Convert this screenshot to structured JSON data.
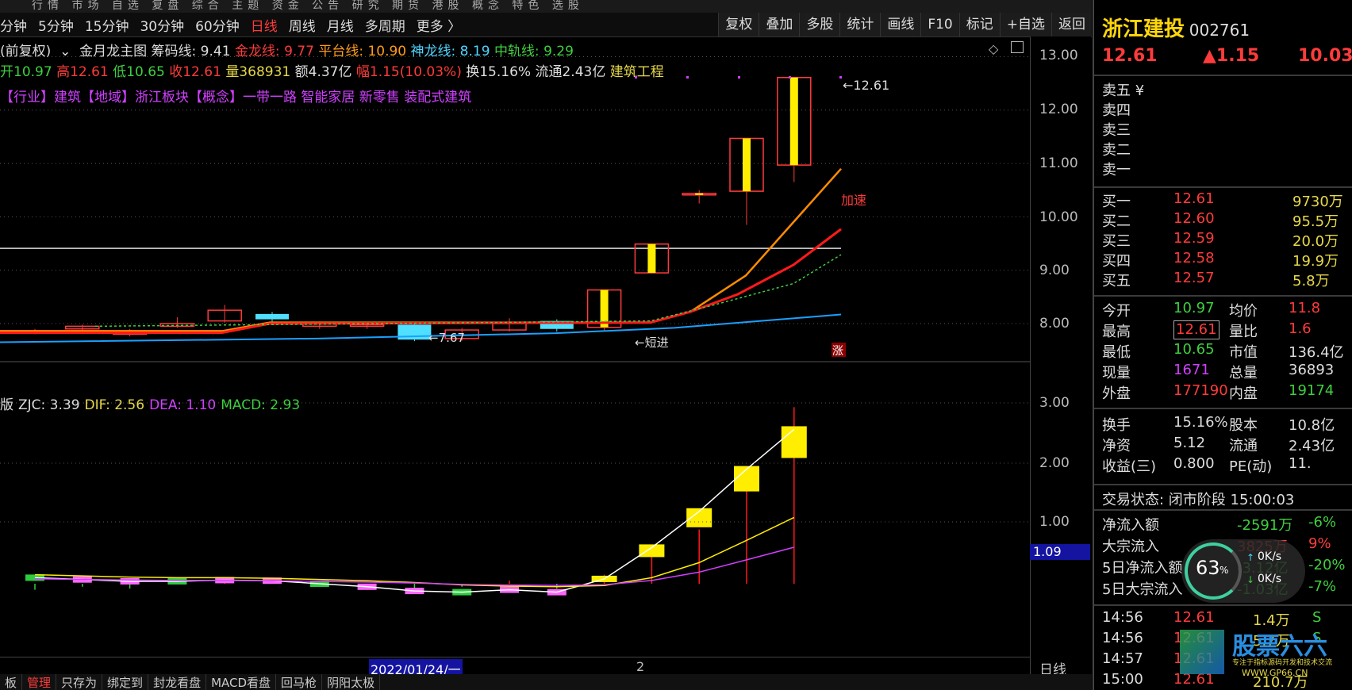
{
  "top_menu": "行情  市场  自选  复盘  综合  主题  资金  公告  研究  期货  港股  概念  特色  选股",
  "period_tabs": [
    "分钟",
    "5分钟",
    "15分钟",
    "30分钟",
    "60分钟",
    "日线",
    "周线",
    "月线",
    "多周期",
    "更多 〉"
  ],
  "active_period": "日线",
  "right_tools": [
    "复权",
    "叠加",
    "多股",
    "统计",
    "画线",
    "F10",
    "标记",
    "+自选",
    "返回"
  ],
  "indicator_line": {
    "prefix": "(前复权)",
    "name": "金月龙主图",
    "chouma": "筹码线: 9.41",
    "jinlong": "金龙线: 9.77",
    "pingtai": "平台线: 10.90",
    "shenlong": "神龙线: 8.19",
    "zhonggui": "中轨线: 9.29"
  },
  "ohlc_line": {
    "open": "开10.97",
    "high": "高12.61",
    "low": "低10.65",
    "close": "收12.61",
    "vol": "量368931",
    "amount": "额4.37亿",
    "change": "幅1.15(10.03%)",
    "turnover": "换15.16%",
    "float": "流通2.43亿",
    "industry": "建筑工程"
  },
  "tags_line": "【行业】建筑【地域】浙江板块【概念】一带一路 智能家居 新零售 装配式建筑",
  "main_chart": {
    "y_ticks": [
      "13.00",
      "12.00",
      "11.00",
      "10.00",
      "9.00",
      "8.00"
    ],
    "last_price_label": "12.61",
    "low_label": "7.67",
    "jiasu": "加速",
    "duanjin": "短进",
    "zhang": "涨"
  },
  "macd_line": {
    "prefix": "版",
    "zjc": "ZJC: 3.39",
    "dif": "DIF: 2.56",
    "dea": "DEA: 1.10",
    "macd": "MACD: 2.93"
  },
  "sub_chart": {
    "y_ticks": [
      "3.00",
      "2.00",
      "1.00"
    ],
    "marker": "1.09"
  },
  "date_label": "2022/01/24/一",
  "date_num": "2",
  "period_badge": "日线",
  "bottom_tabs": [
    "板",
    "管理",
    "只存为",
    "绑定到",
    "封龙看盘",
    "MACD看盘",
    "回马枪",
    "阴阳太极"
  ],
  "stock": {
    "name": "浙江建投",
    "code": "002761",
    "price": "12.61",
    "change": "▲1.15",
    "pct": "10.03%"
  },
  "sell": [
    {
      "label": "卖五 ¥",
      "price": "",
      "vol": ""
    },
    {
      "label": "卖四",
      "price": "",
      "vol": ""
    },
    {
      "label": "卖三",
      "price": "",
      "vol": ""
    },
    {
      "label": "卖二",
      "price": "",
      "vol": ""
    },
    {
      "label": "卖一",
      "price": "",
      "vol": ""
    }
  ],
  "buy": [
    {
      "label": "买一",
      "price": "12.61",
      "vol": "9730万"
    },
    {
      "label": "买二",
      "price": "12.60",
      "vol": "95.5万"
    },
    {
      "label": "买三",
      "price": "12.59",
      "vol": "20.0万"
    },
    {
      "label": "买四",
      "price": "12.58",
      "vol": "19.9万"
    },
    {
      "label": "买五",
      "price": "12.57",
      "vol": "5.8万"
    }
  ],
  "stats": [
    {
      "k1": "今开",
      "v1": "10.97",
      "c1": "green",
      "k2": "均价",
      "v2": "11.8",
      "c2": "red"
    },
    {
      "k1": "最高",
      "v1": "12.61",
      "c1": "red",
      "k2": "量比",
      "v2": "1.6",
      "c2": "red"
    },
    {
      "k1": "最低",
      "v1": "10.65",
      "c1": "green",
      "k2": "市值",
      "v2": "136.4亿",
      "c2": "white"
    },
    {
      "k1": "现量",
      "v1": "1671",
      "c1": "purple",
      "k2": "总量",
      "v2": "36893",
      "c2": "white"
    },
    {
      "k1": "外盘",
      "v1": "177190",
      "c1": "red",
      "k2": "内盘",
      "v2": "19174",
      "c2": "green"
    }
  ],
  "stats2": [
    {
      "k1": "换手",
      "v1": "15.16%",
      "k2": "股本",
      "v2": "10.8亿"
    },
    {
      "k1": "净资",
      "v1": "5.12",
      "k2": "流通",
      "v2": "2.43亿"
    },
    {
      "k1": "收益(三)",
      "v1": "0.800",
      "k2": "PE(动)",
      "v2": "11."
    }
  ],
  "status": "交易状态: 闭市阶段 15:00:03",
  "flows": [
    {
      "k": "净流入额",
      "v": "-2591万",
      "p": "-6%"
    },
    {
      "k": "大宗流入",
      "v": "3825万",
      "p": "9%"
    },
    {
      "k": "5日净流入额",
      "v": "-3.12亿",
      "p": "-20%"
    },
    {
      "k": "5日大宗流入",
      "v": "-1.03亿",
      "p": "-7%"
    }
  ],
  "gauge": {
    "pct": "63",
    "up": "0K/s",
    "down": "0K/s"
  },
  "ticks": [
    {
      "t": "14:56",
      "p": "12.61",
      "v": "1.4万",
      "s": "S"
    },
    {
      "t": "14:56",
      "p": "12.61",
      "v": "5.7万",
      "s": "S"
    },
    {
      "t": "14:57",
      "p": "12.61",
      "v": "",
      "s": ""
    },
    {
      "t": "15:00",
      "p": "12.61",
      "v": "210.7万",
      "s": ""
    }
  ],
  "watermark": {
    "brand": "股票六六",
    "tagline": "专注于指标源码开发和技术交流",
    "url": "WWW.GP66.CN"
  },
  "candles": [
    {
      "o": 7.82,
      "c": 7.86,
      "h": 7.9,
      "l": 7.8
    },
    {
      "o": 7.9,
      "c": 7.95,
      "h": 7.98,
      "l": 7.87
    },
    {
      "o": 7.8,
      "c": 7.86,
      "h": 7.9,
      "l": 7.76
    },
    {
      "o": 7.95,
      "c": 8.0,
      "h": 8.12,
      "l": 7.92
    },
    {
      "o": 8.05,
      "c": 8.25,
      "h": 8.35,
      "l": 8.02
    },
    {
      "o": 8.18,
      "c": 8.08,
      "h": 8.22,
      "l": 8.02
    },
    {
      "o": 7.95,
      "c": 8.0,
      "h": 8.04,
      "l": 7.9
    },
    {
      "o": 7.95,
      "c": 7.98,
      "h": 8.02,
      "l": 7.9
    },
    {
      "o": 7.98,
      "c": 7.7,
      "h": 8.0,
      "l": 7.67
    },
    {
      "o": 7.72,
      "c": 7.88,
      "h": 7.92,
      "l": 7.68
    },
    {
      "o": 7.88,
      "c": 8.0,
      "h": 8.1,
      "l": 7.85
    },
    {
      "o": 8.05,
      "c": 7.9,
      "h": 8.08,
      "l": 7.85
    },
    {
      "o": 7.93,
      "c": 8.63,
      "h": 8.63,
      "l": 7.85
    },
    {
      "o": 8.95,
      "c": 9.49,
      "h": 9.49,
      "l": 8.95
    },
    {
      "o": 10.42,
      "c": 10.44,
      "h": 10.5,
      "l": 10.25
    },
    {
      "o": 10.48,
      "c": 11.47,
      "h": 11.47,
      "l": 9.85
    },
    {
      "o": 10.97,
      "c": 12.61,
      "h": 12.61,
      "l": 10.65
    }
  ],
  "macd_bars": [
    -0.1,
    -0.05,
    -0.08,
    0.02,
    0.05,
    0.03,
    0.01,
    -0.03,
    -0.15,
    -0.05,
    0.05,
    -0.08,
    0.15,
    0.55,
    0.9,
    1.55,
    2.93
  ],
  "dif_vals": [
    0.1,
    0.07,
    0.04,
    0.04,
    0.06,
    0.05,
    0.0,
    -0.05,
    -0.12,
    -0.14,
    -0.1,
    -0.14,
    0.08,
    0.6,
    1.2,
    1.9,
    2.56
  ],
  "dea_vals": [
    0.15,
    0.13,
    0.11,
    0.1,
    0.1,
    0.09,
    0.07,
    0.05,
    0.02,
    -0.02,
    -0.04,
    -0.05,
    -0.03,
    0.1,
    0.35,
    0.72,
    1.1
  ]
}
